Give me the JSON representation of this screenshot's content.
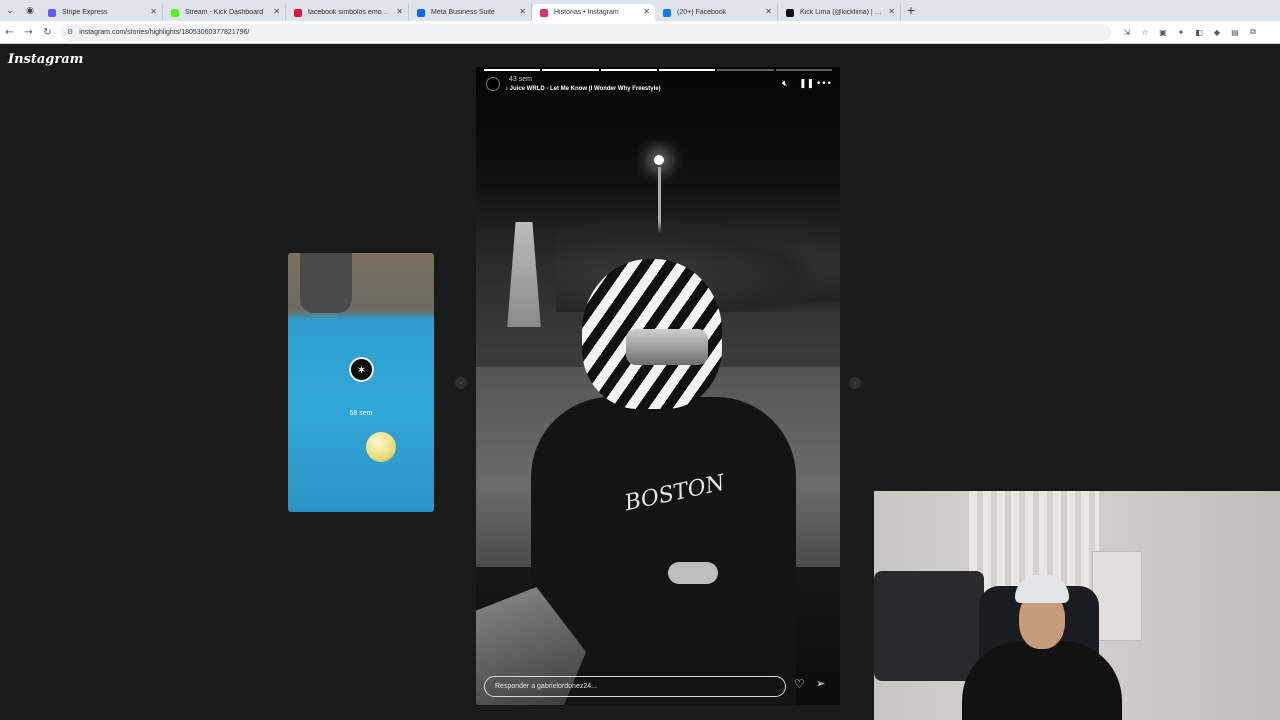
{
  "browser": {
    "tabs": [
      {
        "label": "Stripe Express",
        "color": "#635bff",
        "active": false
      },
      {
        "label": "Stream - Kick Dashboard",
        "color": "#53fc18",
        "active": false
      },
      {
        "label": "facebook simbolos emoticone",
        "color": "#d81b3b",
        "active": false
      },
      {
        "label": "Meta Business Suite",
        "color": "#0866ff",
        "active": false
      },
      {
        "label": "Historias • Instagram",
        "color": "#e1306c",
        "active": true
      },
      {
        "label": "(20+) Facebook",
        "color": "#1877f2",
        "active": false
      },
      {
        "label": "Kick Lima (@kicklima) | TikTok",
        "color": "#111111",
        "active": false
      }
    ],
    "url": "instagram.com/stories/highlights/18053060377821796/"
  },
  "instagram": {
    "logo": "Instagram",
    "previous_story": {
      "time": "58 sem"
    },
    "story": {
      "time": "43 sem",
      "song": "Juice WRLD - Let Me Know (I Wonder Why Freestyle)",
      "shirt_text": "BOSTON",
      "segments_total": 6,
      "segments_done": 4,
      "reply_placeholder": "Responder a gabrielordonez24..."
    }
  },
  "icons": {
    "mute": "mute-icon",
    "pause": "pause-icon",
    "more": "more-icon",
    "heart": "heart-icon",
    "send": "send-icon"
  }
}
